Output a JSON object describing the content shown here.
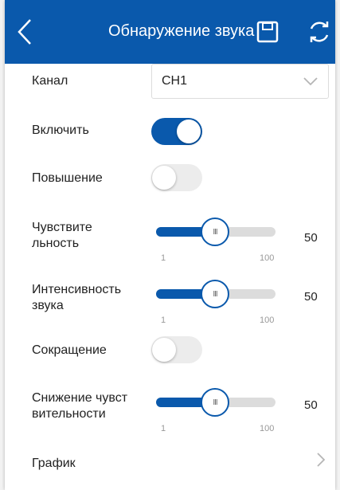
{
  "header": {
    "title": "Обнаружение звука"
  },
  "channel": {
    "label": "Канал",
    "value": "CH1"
  },
  "enable": {
    "label": "Включить",
    "on": true
  },
  "boost": {
    "label": "Повышение",
    "on": false
  },
  "sensitivity": {
    "label_line1": "Чувствите",
    "label_line2": "льность",
    "value": "50",
    "min": "1",
    "max": "100"
  },
  "intensity": {
    "label_line1": "Интенсивность",
    "label_line2": "звука",
    "value": "50",
    "min": "1",
    "max": "100"
  },
  "reduction": {
    "label": "Сокращение",
    "on": false
  },
  "sensitivity_reduction": {
    "label_line1": "Снижение чувст",
    "label_line2": "вительности",
    "value": "50",
    "min": "1",
    "max": "100"
  },
  "schedule": {
    "label": "График"
  },
  "colors": {
    "accent": "#0a59ac",
    "track": "#dcdcdc"
  }
}
